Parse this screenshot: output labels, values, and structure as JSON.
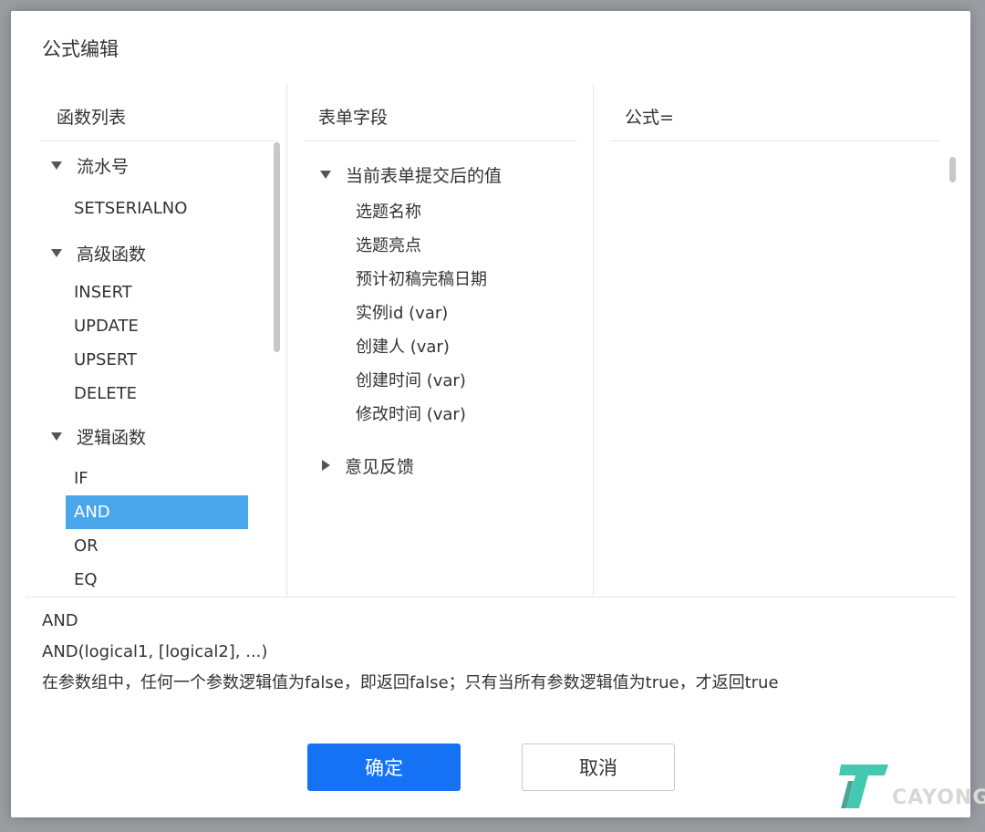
{
  "dialog": {
    "title": "公式编辑"
  },
  "function_panel": {
    "header": "函数列表",
    "groups": [
      {
        "label": "流水号",
        "expanded": true,
        "items": [
          "SETSERIALNO"
        ]
      },
      {
        "label": "高级函数",
        "expanded": true,
        "items": [
          "INSERT",
          "UPDATE",
          "UPSERT",
          "DELETE"
        ]
      },
      {
        "label": "逻辑函数",
        "expanded": true,
        "items": [
          "IF",
          "AND",
          "OR",
          "EQ"
        ]
      }
    ],
    "selected": "AND"
  },
  "field_panel": {
    "header": "表单字段",
    "groups": [
      {
        "label": "当前表单提交后的值",
        "expanded": true,
        "items": [
          "选题名称",
          "选题亮点",
          "预计初稿完稿日期",
          "实例id (var)",
          "创建人 (var)",
          "创建时间 (var)",
          "修改时间 (var)"
        ]
      },
      {
        "label": "意见反馈",
        "expanded": false,
        "items": []
      }
    ]
  },
  "formula_panel": {
    "header": "公式="
  },
  "description": {
    "name": "AND",
    "signature": "AND(logical1, [logical2], ...)",
    "text": "在参数组中，任何一个参数逻辑值为false，即返回false；只有当所有参数逻辑值为true，才返回true"
  },
  "buttons": {
    "ok": "确定",
    "cancel": "取消"
  },
  "colors": {
    "primary_button": "#1672f5",
    "selected_item": "#4aa6ea"
  },
  "watermark": {
    "text": "CAYONG"
  }
}
